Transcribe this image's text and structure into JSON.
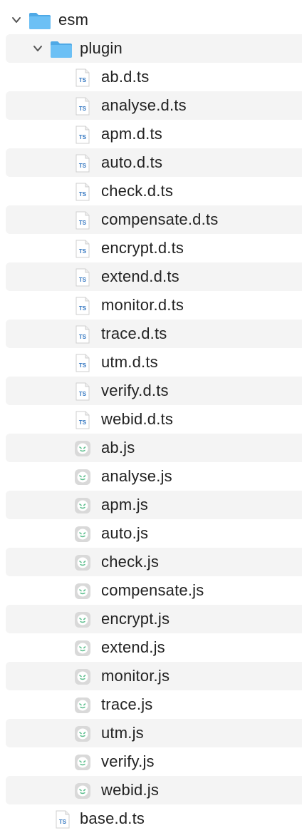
{
  "tree": {
    "root": {
      "label": "esm",
      "expanded": true,
      "icon": "folder-icon"
    },
    "folder": {
      "label": "plugin",
      "expanded": true,
      "icon": "folder-icon"
    },
    "files": [
      {
        "label": "ab.d.ts",
        "icon": "typescript-file-icon"
      },
      {
        "label": "analyse.d.ts",
        "icon": "typescript-file-icon"
      },
      {
        "label": "apm.d.ts",
        "icon": "typescript-file-icon"
      },
      {
        "label": "auto.d.ts",
        "icon": "typescript-file-icon"
      },
      {
        "label": "check.d.ts",
        "icon": "typescript-file-icon"
      },
      {
        "label": "compensate.d.ts",
        "icon": "typescript-file-icon"
      },
      {
        "label": "encrypt.d.ts",
        "icon": "typescript-file-icon"
      },
      {
        "label": "extend.d.ts",
        "icon": "typescript-file-icon"
      },
      {
        "label": "monitor.d.ts",
        "icon": "typescript-file-icon"
      },
      {
        "label": "trace.d.ts",
        "icon": "typescript-file-icon"
      },
      {
        "label": "utm.d.ts",
        "icon": "typescript-file-icon"
      },
      {
        "label": "verify.d.ts",
        "icon": "typescript-file-icon"
      },
      {
        "label": "webid.d.ts",
        "icon": "typescript-file-icon"
      },
      {
        "label": "ab.js",
        "icon": "javascript-file-icon"
      },
      {
        "label": "analyse.js",
        "icon": "javascript-file-icon"
      },
      {
        "label": "apm.js",
        "icon": "javascript-file-icon"
      },
      {
        "label": "auto.js",
        "icon": "javascript-file-icon"
      },
      {
        "label": "check.js",
        "icon": "javascript-file-icon"
      },
      {
        "label": "compensate.js",
        "icon": "javascript-file-icon"
      },
      {
        "label": "encrypt.js",
        "icon": "javascript-file-icon"
      },
      {
        "label": "extend.js",
        "icon": "javascript-file-icon"
      },
      {
        "label": "monitor.js",
        "icon": "javascript-file-icon"
      },
      {
        "label": "trace.js",
        "icon": "javascript-file-icon"
      },
      {
        "label": "utm.js",
        "icon": "javascript-file-icon"
      },
      {
        "label": "verify.js",
        "icon": "javascript-file-icon"
      },
      {
        "label": "webid.js",
        "icon": "javascript-file-icon"
      }
    ],
    "sibling": {
      "label": "base.d.ts",
      "icon": "typescript-file-icon"
    },
    "ts_badge": "TS",
    "colors": {
      "folder": "#6cc0f5",
      "folder_tab": "#4fa9e6",
      "ts_text": "#2f74c0",
      "js_icon": "#d9d9d9",
      "js_face": "#5fbf8f",
      "row_alt": "#f4f4f4",
      "text": "#222222"
    }
  }
}
